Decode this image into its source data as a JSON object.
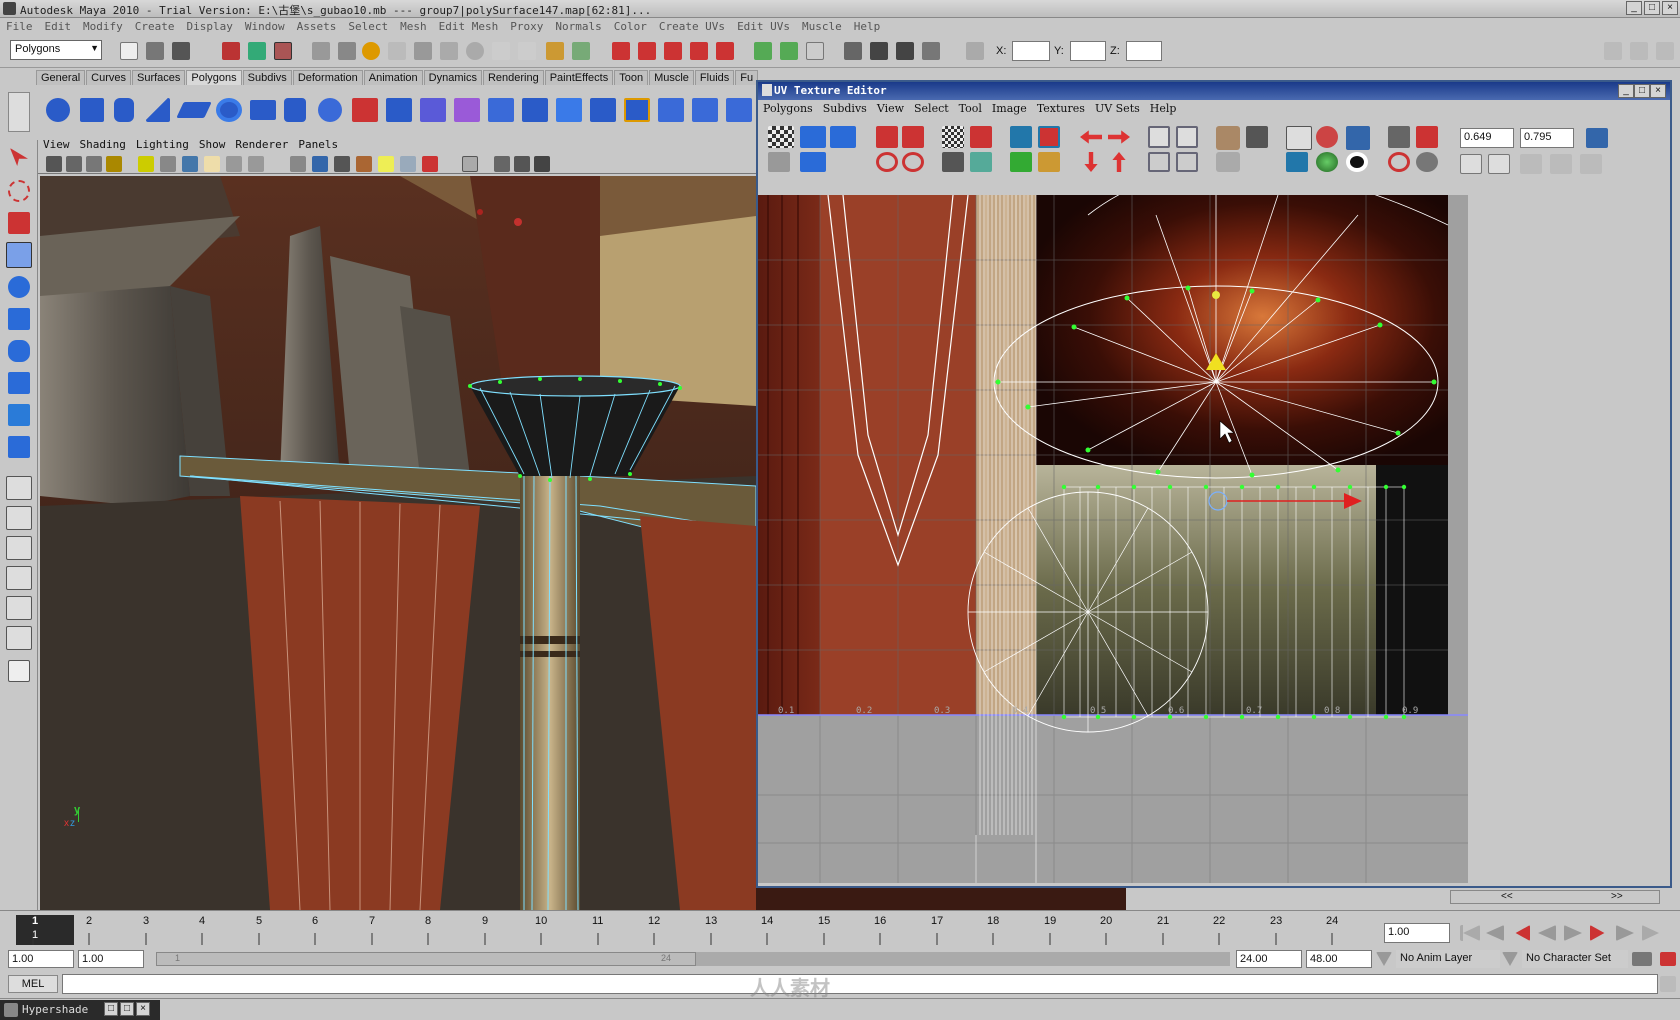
{
  "window": {
    "title": "Autodesk Maya 2010 - Trial Version: E:\\古堡\\s_gubao10.mb   ---   group7|polySurface147.map[62:81]...",
    "controls": [
      "_",
      "□",
      "×"
    ]
  },
  "menubar": [
    "File",
    "Edit",
    "Modify",
    "Create",
    "Display",
    "Window",
    "Assets",
    "Select",
    "Mesh",
    "Edit Mesh",
    "Proxy",
    "Normals",
    "Color",
    "Create UVs",
    "Edit UVs",
    "Muscle",
    "Help"
  ],
  "status_line": {
    "menu_set": "Polygons",
    "x_label": "X:",
    "y_label": "Y:",
    "z_label": "Z:"
  },
  "shelf_tabs": [
    "General",
    "Curves",
    "Surfaces",
    "Polygons",
    "Subdivs",
    "Deformation",
    "Animation",
    "Dynamics",
    "Rendering",
    "PaintEffects",
    "Toon",
    "Muscle",
    "Fluids",
    "Fu"
  ],
  "active_shelf_tab": "Polygons",
  "viewport_menu": [
    "View",
    "Shading",
    "Lighting",
    "Show",
    "Renderer",
    "Panels"
  ],
  "viewport_axis": {
    "y": "y",
    "x": "x",
    "z": "z"
  },
  "uv_editor": {
    "title": "UV Texture Editor",
    "menu": [
      "Polygons",
      "Subdivs",
      "View",
      "Select",
      "Tool",
      "Image",
      "Textures",
      "UV Sets",
      "Help"
    ],
    "u_value": "0.649",
    "v_value": "0.795",
    "tick_labels": [
      "0.1",
      "0.2",
      "0.3",
      "0.4",
      "0.5",
      "0.6",
      "0.7",
      "0.8",
      "0.9"
    ],
    "scroll_left": "<<",
    "scroll_right": ">>"
  },
  "timeline": {
    "ticks": [
      "1",
      "2",
      "3",
      "4",
      "5",
      "6",
      "7",
      "8",
      "9",
      "10",
      "11",
      "12",
      "13",
      "14",
      "15",
      "16",
      "17",
      "18",
      "19",
      "20",
      "21",
      "22",
      "23",
      "24"
    ],
    "current_frame": "1",
    "current_time_field": "1.00"
  },
  "range": {
    "start": "1.00",
    "playback_start": "1.00",
    "range_marker_start": "1",
    "range_marker_end": "24",
    "playback_end": "24.00",
    "end": "48.00",
    "anim_layer": "No Anim Layer",
    "character_set": "No Character Set"
  },
  "command_line": {
    "label": "MEL"
  },
  "bottom": {
    "panel": "Hypershade"
  },
  "watermark": "人人素材"
}
